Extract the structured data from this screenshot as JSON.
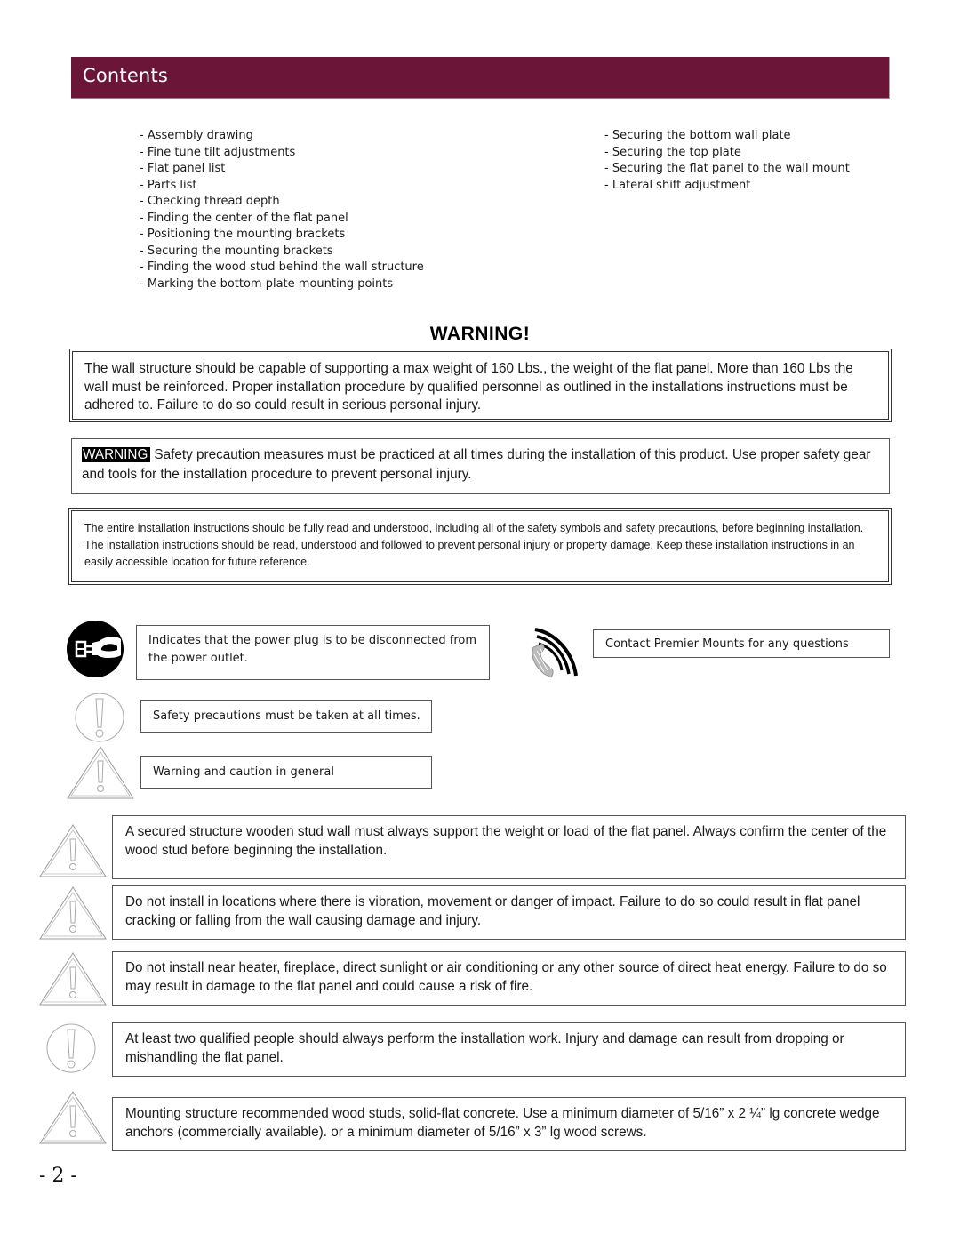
{
  "header": {
    "title": "Contents"
  },
  "toc": {
    "left": [
      "- Assembly drawing",
      "- Fine tune tilt adjustments",
      "- Flat panel list",
      "- Parts list",
      "- Checking thread depth",
      "- Finding the center of the flat panel",
      "- Positioning the mounting brackets",
      "- Securing the mounting brackets",
      "- Finding the wood stud behind the wall structure",
      "- Marking the bottom plate mounting points"
    ],
    "right": [
      "- Securing the bottom wall plate",
      "- Securing the top plate",
      "- Securing the flat panel to the wall mount",
      "- Lateral shift adjustment"
    ]
  },
  "warning_heading": "WARNING!",
  "warning_boxes": {
    "weight": "The wall structure should be capable of supporting a max weight of 160 Lbs., the weight of the flat panel. More than 160 Lbs the wall must be reinforced. Proper installation procedure by qualified personnel as outlined in the installations instructions must be adhered to. Failure to do so could result in serious personal injury.",
    "safety_tag": "WARNING",
    "safety": "Safety precaution measures must be practiced at all times during the installation of this product. Use proper safety gear and tools for the installation procedure to prevent personal injury.",
    "read_instructions": "The entire installation instructions should be fully read and understood, including all of the safety symbols and safety precautions, before beginning installation.  The installation instructions should be read, understood and followed to prevent personal injury or property damage.  Keep these installation instructions in an easily accessible location for future reference."
  },
  "legend": {
    "unplug": {
      "icon": "unplug-icon",
      "text": "Indicates that the power plug is to be disconnected from the power outlet."
    },
    "contact": {
      "icon": "phone-icon",
      "text": "Contact Premier Mounts for any questions"
    },
    "precaution": {
      "icon": "exclamation-circle-icon",
      "text": "Safety precautions must be taken at all times."
    },
    "caution": {
      "icon": "warning-triangle-icon",
      "text": "Warning and caution in general"
    }
  },
  "notes": [
    {
      "icon": "warning-triangle-icon",
      "text": "A secured structure wooden stud wall must always support the weight or load of the flat panel.  Always confirm the center of the wood stud before beginning the installation."
    },
    {
      "icon": "warning-triangle-icon",
      "text": "Do not install in locations where there is vibration, movement or danger of impact.  Failure to do so could result in flat panel cracking or falling from the wall causing damage and injury."
    },
    {
      "icon": "warning-triangle-icon",
      "text": "Do not install near heater, fireplace, direct sunlight or air conditioning or any other source of direct heat energy.  Failure to do so may result in damage to the flat panel and could cause a risk of fire."
    },
    {
      "icon": "exclamation-circle-icon",
      "text": "At least two qualified people should always perform the installation work.  Injury and damage can result from dropping or mishandling the flat panel."
    },
    {
      "icon": "warning-triangle-icon",
      "text": "Mounting structure recommended wood studs, solid-flat concrete. Use a minimum diameter of 5/16” x 2 ¼” lg concrete wedge anchors (commercially available). or a minimum diameter of 5/16” x 3” lg wood screws."
    }
  ],
  "page_number": "- 2 -",
  "colors": {
    "header_bg": "#6b1538",
    "header_text": "#ffffff"
  }
}
